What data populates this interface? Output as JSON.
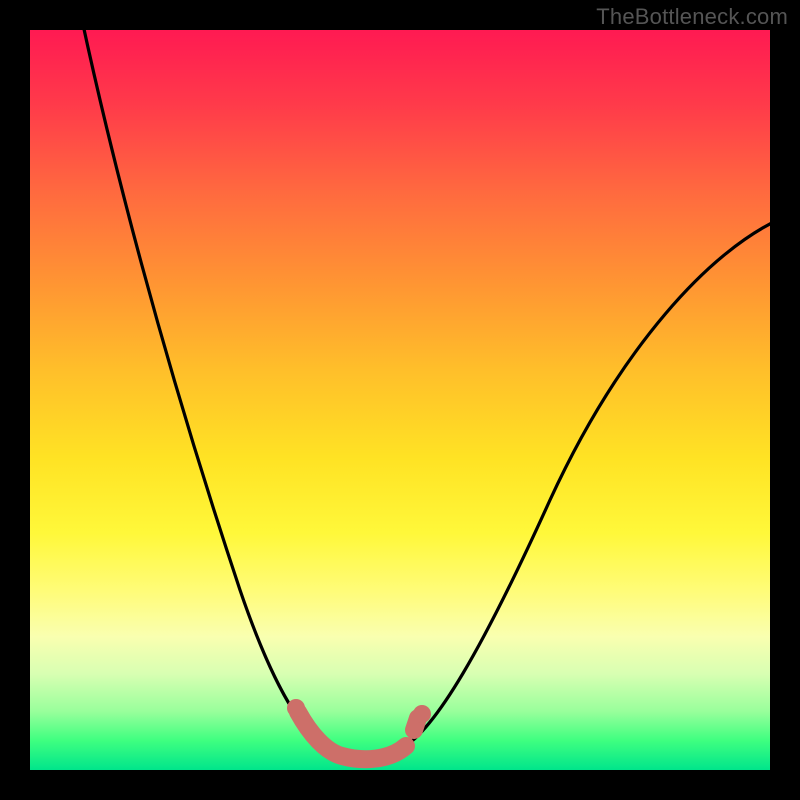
{
  "watermark": "TheBottleneck.com",
  "colors": {
    "frame": "#000000",
    "curve_stroke": "#000000",
    "marker_stroke": "#cd6f69",
    "gradient_top": "#ff1a52",
    "gradient_bottom": "#00e58b"
  },
  "chart_data": {
    "type": "line",
    "title": "",
    "xlabel": "",
    "ylabel": "",
    "xlim": [
      0,
      100
    ],
    "ylim": [
      0,
      100
    ],
    "grid": false,
    "notes": "Single V-shaped bottleneck curve on a red-to-green vertical gradient. Background color approximates bottleneck percentage (red high, green low). Axes have no numeric ticks.",
    "series": [
      {
        "name": "bottleneck-curve",
        "x": [
          5,
          10,
          15,
          20,
          25,
          30,
          34,
          37,
          40,
          42,
          44,
          48,
          52,
          56,
          60,
          66,
          74,
          82,
          90,
          100
        ],
        "values": [
          100,
          86,
          72,
          58,
          44,
          30,
          18,
          10,
          4,
          1,
          0,
          0,
          2,
          6,
          12,
          22,
          38,
          52,
          62,
          72
        ]
      },
      {
        "name": "low-bottleneck-band",
        "x": [
          37,
          40,
          42,
          44,
          48,
          52
        ],
        "values": [
          10,
          4,
          1,
          0,
          0,
          2
        ]
      }
    ]
  }
}
